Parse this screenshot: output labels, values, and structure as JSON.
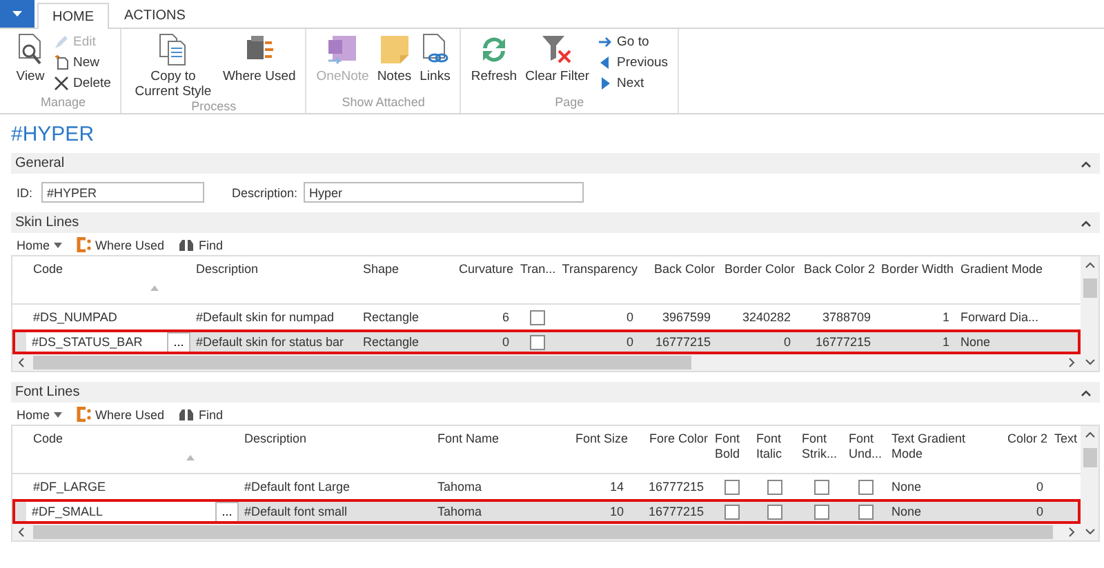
{
  "tabs": [
    {
      "label": "HOME",
      "selected": true
    },
    {
      "label": "ACTIONS",
      "selected": false
    }
  ],
  "ribbon": {
    "groups": [
      {
        "label": "Manage",
        "buttons": [
          {
            "label": "View",
            "kind": "large",
            "disabled": false
          },
          {
            "label": "Edit",
            "kind": "small",
            "disabled": true
          },
          {
            "label": "New",
            "kind": "small",
            "disabled": false
          },
          {
            "label": "Delete",
            "kind": "small",
            "disabled": false
          }
        ]
      },
      {
        "label": "Process",
        "buttons": [
          {
            "label": "Copy to Current Style",
            "kind": "large",
            "disabled": false
          },
          {
            "label": "Where Used",
            "kind": "large",
            "disabled": false
          }
        ]
      },
      {
        "label": "Show Attached",
        "buttons": [
          {
            "label": "OneNote",
            "kind": "large",
            "disabled": true
          },
          {
            "label": "Notes",
            "kind": "large",
            "disabled": false
          },
          {
            "label": "Links",
            "kind": "large",
            "disabled": false
          }
        ]
      },
      {
        "label": "Page",
        "buttons": [
          {
            "label": "Refresh",
            "kind": "large",
            "disabled": false
          },
          {
            "label": "Clear Filter",
            "kind": "large",
            "disabled": false
          },
          {
            "label": "Go to",
            "kind": "small",
            "disabled": false
          },
          {
            "label": "Previous",
            "kind": "small",
            "disabled": false
          },
          {
            "label": "Next",
            "kind": "small",
            "disabled": false
          }
        ]
      }
    ]
  },
  "page_title": "#HYPER",
  "general": {
    "title": "General",
    "expanded": true,
    "fields": [
      {
        "label": "ID:",
        "value": "#HYPER"
      },
      {
        "label": "Description:",
        "value": "Hyper"
      }
    ]
  },
  "skin_lines": {
    "title": "Skin Lines",
    "expanded": true,
    "toolbar": [
      {
        "label": "Home",
        "kind": "menu"
      },
      {
        "label": "Where Used",
        "kind": "where"
      },
      {
        "label": "Find",
        "kind": "find"
      }
    ],
    "columns": [
      {
        "label": "Code",
        "kind": "text",
        "sorted": true
      },
      {
        "label": "Description",
        "kind": "text"
      },
      {
        "label": "Shape",
        "kind": "text"
      },
      {
        "label": "Curvature",
        "kind": "number"
      },
      {
        "label": "Tran...",
        "kind": "check"
      },
      {
        "label": "Transparency",
        "kind": "number"
      },
      {
        "label": "Back Color",
        "kind": "number"
      },
      {
        "label": "Border Color",
        "kind": "number"
      },
      {
        "label": "Back Color 2",
        "kind": "number"
      },
      {
        "label": "Border Width",
        "kind": "number"
      },
      {
        "label": "Gradient Mode",
        "kind": "text"
      }
    ],
    "rows": [
      {
        "selected": false,
        "cells": [
          "#DS_NUMPAD",
          "#Default skin for numpad",
          "Rectangle",
          "6",
          {
            "checked": false
          },
          "0",
          "3967599",
          "3240282",
          "3788709",
          "1",
          "Forward Dia..."
        ]
      },
      {
        "selected": true,
        "lookup_button": "...",
        "cells": [
          "#DS_STATUS_BAR",
          "#Default skin for status bar",
          "Rectangle",
          "0",
          {
            "checked": false
          },
          "0",
          "16777215",
          "0",
          "16777215",
          "1",
          "None"
        ]
      }
    ]
  },
  "font_lines": {
    "title": "Font Lines",
    "expanded": true,
    "toolbar": [
      {
        "label": "Home",
        "kind": "menu"
      },
      {
        "label": "Where Used",
        "kind": "where"
      },
      {
        "label": "Find",
        "kind": "find"
      }
    ],
    "columns": [
      {
        "label": "Code",
        "kind": "text",
        "sorted": true
      },
      {
        "label": "Description",
        "kind": "text"
      },
      {
        "label": "Font Name",
        "kind": "text"
      },
      {
        "label": "Font Size",
        "kind": "number"
      },
      {
        "label": "Fore Color",
        "kind": "number"
      },
      {
        "label": "Font Bold",
        "kind": "check"
      },
      {
        "label": "Font Italic",
        "kind": "check"
      },
      {
        "label": "Font Strik...",
        "kind": "check"
      },
      {
        "label": "Font Und...",
        "kind": "check"
      },
      {
        "label": "Text Gradient Mode",
        "kind": "text"
      },
      {
        "label": "Color 2",
        "kind": "number"
      },
      {
        "label": "Text",
        "kind": "text"
      }
    ],
    "rows": [
      {
        "selected": false,
        "cells": [
          "#DF_LARGE",
          "#Default font Large",
          "Tahoma",
          "14",
          "16777215",
          {
            "checked": false
          },
          {
            "checked": false
          },
          {
            "checked": false
          },
          {
            "checked": false
          },
          "None",
          "0",
          null
        ]
      },
      {
        "selected": true,
        "lookup_button": "...",
        "cells": [
          "#DF_SMALL",
          "#Default font small",
          "Tahoma",
          "10",
          "16777215",
          {
            "checked": false
          },
          {
            "checked": false
          },
          {
            "checked": false
          },
          {
            "checked": false
          },
          "None",
          "0",
          null
        ]
      }
    ]
  }
}
